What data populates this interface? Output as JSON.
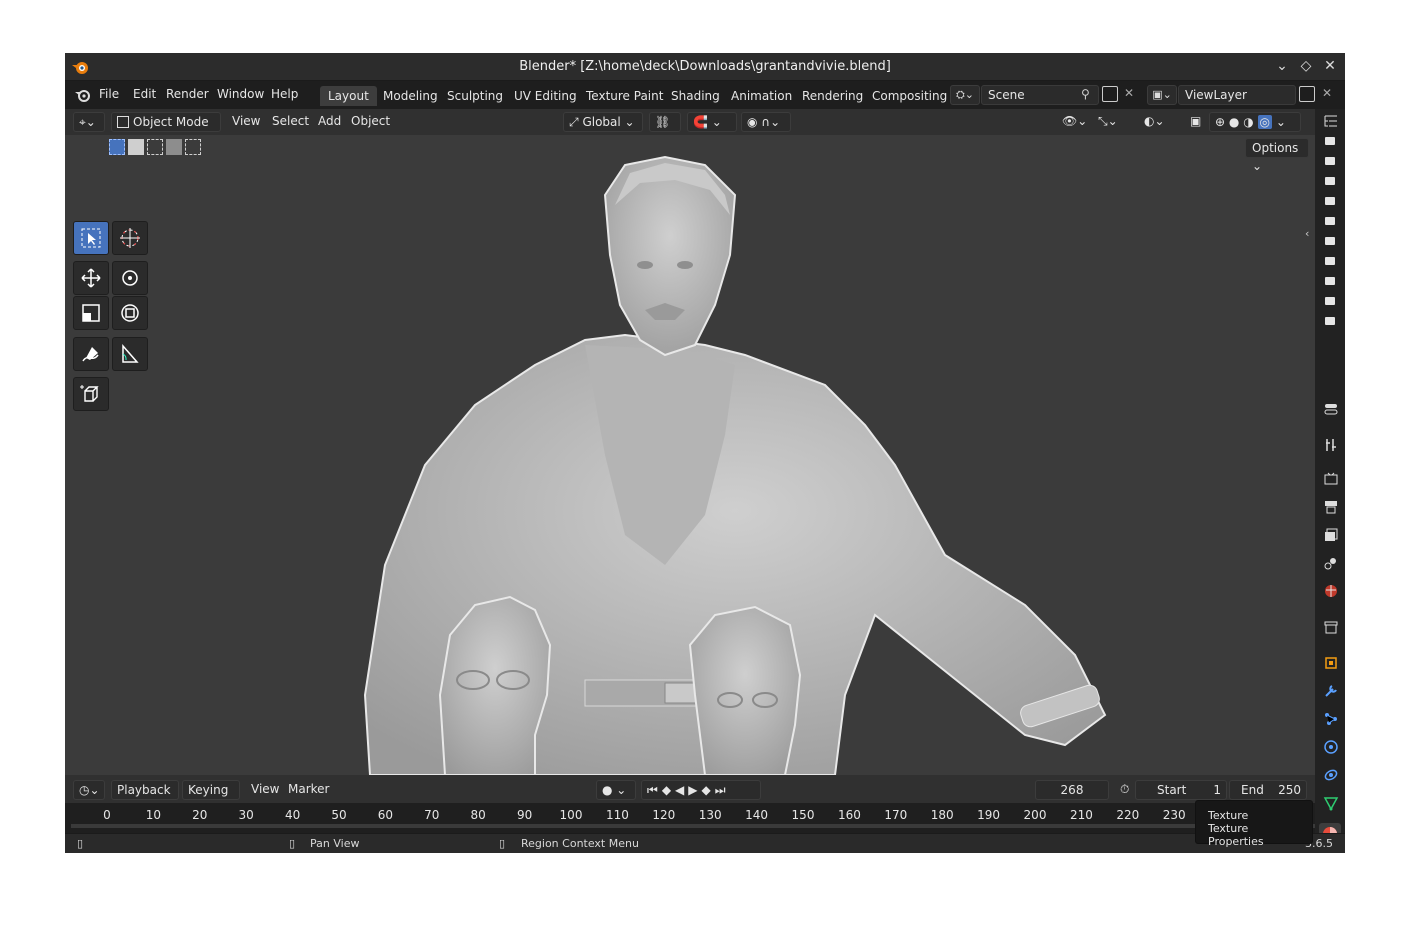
{
  "window": {
    "title": "Blender* [Z:\\home\\deck\\Downloads\\grantandvivie.blend]",
    "controls": [
      "chevron-down-icon",
      "diamond-icon",
      "close-icon"
    ]
  },
  "menubar": {
    "menus": [
      "File",
      "Edit",
      "Render",
      "Window",
      "Help"
    ],
    "workspaces": [
      "Layout",
      "Modeling",
      "Sculpting",
      "UV Editing",
      "Texture Paint",
      "Shading",
      "Animation",
      "Rendering",
      "Compositing"
    ],
    "active_workspace": "Layout",
    "scene": "Scene",
    "view_layer": "ViewLayer"
  },
  "viewport_header": {
    "mode": "Object Mode",
    "menus": [
      "View",
      "Select",
      "Add",
      "Object"
    ],
    "orientation": "Global",
    "options_label": "Options"
  },
  "toolbar": {
    "tools": [
      "select-box-icon",
      "cursor-icon",
      "move-icon",
      "rotate-icon",
      "scale-icon",
      "transform-icon",
      "annotate-icon",
      "measure-icon",
      "add-cube-icon"
    ]
  },
  "timeline": {
    "menus": [
      "Playback",
      "Keying",
      "View",
      "Marker"
    ],
    "current_frame": "268",
    "start_label": "Start",
    "start_value": "1",
    "end_label": "End",
    "end_value": "250",
    "ruler_ticks": [
      "0",
      "10",
      "20",
      "30",
      "40",
      "50",
      "60",
      "70",
      "80",
      "90",
      "100",
      "110",
      "120",
      "130",
      "140",
      "150",
      "160",
      "170",
      "180",
      "190",
      "200",
      "210",
      "220",
      "230"
    ]
  },
  "statusbar": {
    "pan_view": "Pan View",
    "region_context_menu": "Region Context Menu",
    "version": "3.6.5"
  },
  "tooltip": {
    "line1": "Texture",
    "line2": "Texture Properties"
  },
  "colors": {
    "accent": "#4673bd",
    "viewport_bg": "#3b3b3b",
    "model": "#bdbdbd"
  }
}
